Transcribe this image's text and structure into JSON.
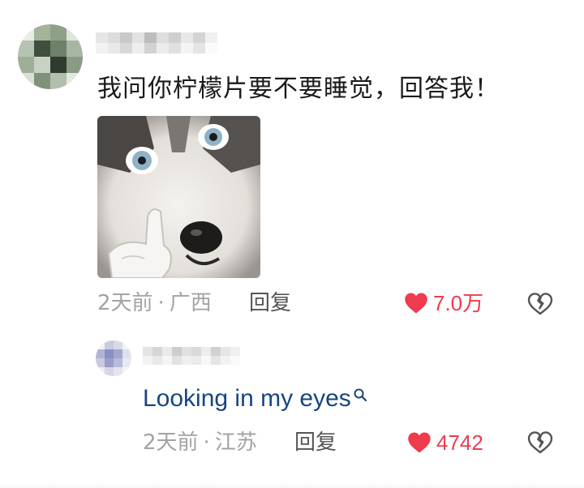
{
  "comment": {
    "text": "我问你柠檬片要不要睡觉，回答我！",
    "image_alt": "husky meme",
    "meta": {
      "time": "2天前",
      "location": "广西"
    },
    "reply_label": "回复",
    "like_count": "7.0万"
  },
  "reply": {
    "text": "Looking in my eyes",
    "meta": {
      "time": "2天前",
      "location": "江苏"
    },
    "reply_label": "回复",
    "like_count": "4742"
  },
  "colors": {
    "like_red": "#ef3b4e",
    "reply_text_blue": "#17467f",
    "meta_gray": "#a3a3a3"
  },
  "icons": {
    "like": "heart-filled-icon",
    "dislike": "broken-heart-icon",
    "search": "search-icon"
  }
}
